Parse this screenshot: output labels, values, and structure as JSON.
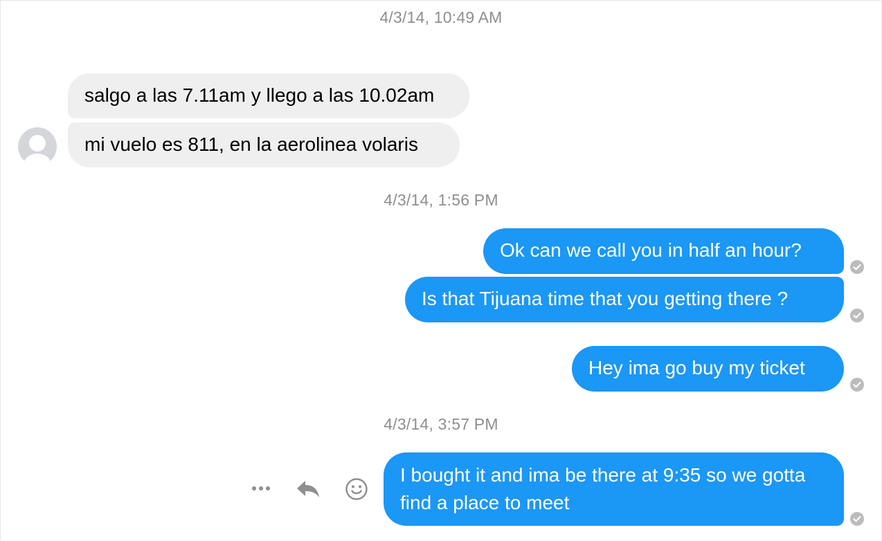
{
  "timestamps": [
    "4/3/14, 10:49 AM",
    "4/3/14, 1:56 PM",
    "4/3/14, 3:57 PM"
  ],
  "messages": [
    {
      "text": "salgo a las 7.11am y llego a las 10.02am",
      "direction": "incoming"
    },
    {
      "text": "mi vuelo es 811, en la aerolinea volaris",
      "direction": "incoming"
    },
    {
      "text": "Ok can we call you in half an hour?",
      "direction": "outgoing",
      "status": "sent"
    },
    {
      "text": "Is that Tijuana time that you getting there ?",
      "direction": "outgoing",
      "status": "sent"
    },
    {
      "text": "Hey ima go buy my ticket",
      "direction": "outgoing",
      "status": "sent"
    },
    {
      "text": "I bought it and  ima be there at 9:35 so we gotta find a place to meet",
      "direction": "outgoing",
      "status": "sent"
    }
  ],
  "hover_actions": [
    "more-icon",
    "reply-icon",
    "emoji-icon"
  ],
  "colors": {
    "outgoing_bubble": "#1b97f5",
    "incoming_bubble": "#efefef",
    "timestamp_text": "#8e8e8e",
    "sent_check": "#bcbcbc"
  }
}
